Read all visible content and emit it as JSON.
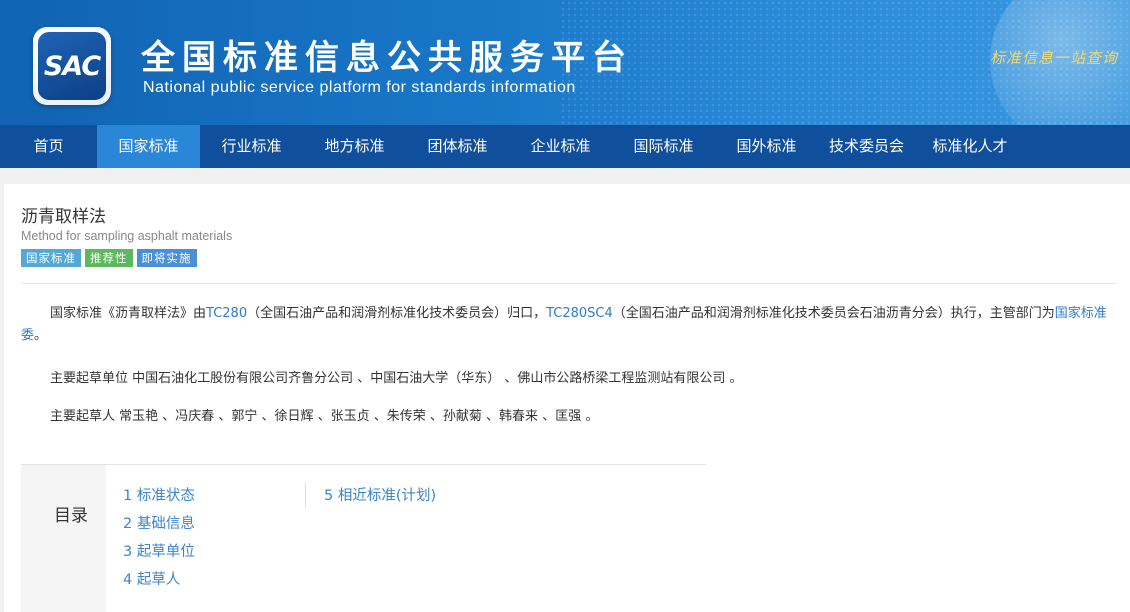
{
  "header": {
    "logo_text": "SAC",
    "title_cn": "全国标准信息公共服务平台",
    "title_en": "National public service platform  for standards information",
    "slogan": "标准信息一站查询"
  },
  "nav": {
    "items": [
      {
        "label": "首页"
      },
      {
        "label": "国家标准"
      },
      {
        "label": "行业标准"
      },
      {
        "label": "地方标准"
      },
      {
        "label": "团体标准"
      },
      {
        "label": "企业标准"
      },
      {
        "label": "国际标准"
      },
      {
        "label": "国外标准"
      },
      {
        "label": "技术委员会"
      },
      {
        "label": "标准化人才"
      }
    ],
    "active_index": 1
  },
  "standard": {
    "title": "沥青取样法",
    "subtitle": "Method for sampling asphalt materials",
    "badges": [
      {
        "label": "国家标准",
        "color": "#55a7d6"
      },
      {
        "label": "推荐性",
        "color": "#5cb85c"
      },
      {
        "label": "即将实施",
        "color": "#4a90d9"
      }
    ]
  },
  "description": {
    "p1_prefix": "国家标准《沥青取样法》由",
    "p1_tc1": "TC280",
    "p1_tc1_desc": "（全国石油产品和润滑剂标准化技术委员会）归口，",
    "p1_tc2": "TC280SC4",
    "p1_tc2_desc": "（全国石油产品和润滑剂标准化技术委员会石油沥青分会）执行，主管部门为",
    "p1_authority": "国家标准委",
    "p1_suffix": "。",
    "p2": "主要起草单位 中国石油化工股份有限公司齐鲁分公司 、中国石油大学（华东） 、佛山市公路桥梁工程监测站有限公司 。",
    "p3": "主要起草人 常玉艳 、冯庆春 、郭宁 、徐日辉 、张玉贞 、朱传荣 、孙献菊 、韩春来 、匡强 。"
  },
  "toc": {
    "label": "目录",
    "items": [
      "1  标准状态",
      "2  基础信息",
      "3  起草单位",
      "4  起草人",
      "5  相近标准(计划)"
    ]
  },
  "colors": {
    "nav_bg": "#0f4f9c",
    "nav_active": "#2a86d6",
    "link": "#2f7cc8"
  }
}
